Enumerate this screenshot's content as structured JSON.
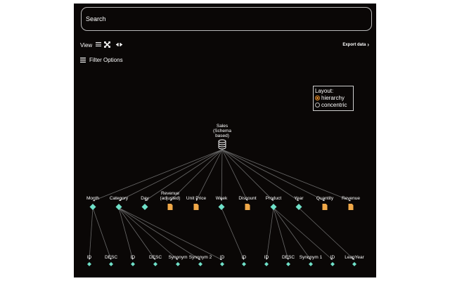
{
  "search": {
    "placeholder": "Search"
  },
  "toolbar": {
    "view_label": "View",
    "icons": [
      "list-icon",
      "expand-icon",
      "collapse-icon"
    ],
    "export_label": "Export data"
  },
  "filter": {
    "label": "Filter Options"
  },
  "layout": {
    "title": "Layout:",
    "options": [
      {
        "label": "hierarchy",
        "selected": true
      },
      {
        "label": "concentric",
        "selected": false
      }
    ]
  },
  "colors": {
    "background": "#0a0706",
    "diamond_node": "#6fe0c8",
    "file_node": "#f0a848",
    "edge": "#6a6a6a",
    "radio_selected": "#e08a2a"
  },
  "graph": {
    "root": {
      "label_lines": [
        "Sales",
        "(Schema",
        "based)"
      ],
      "icon": "database-icon"
    },
    "level1": [
      {
        "lines": [
          "Month"
        ],
        "type": "diamond"
      },
      {
        "lines": [
          "Category"
        ],
        "type": "diamond"
      },
      {
        "lines": [
          "Day"
        ],
        "type": "diamond"
      },
      {
        "lines": [
          "Revenue",
          "(adjusted)"
        ],
        "type": "file"
      },
      {
        "lines": [
          "Unit Price"
        ],
        "type": "file"
      },
      {
        "lines": [
          "Week"
        ],
        "type": "diamond"
      },
      {
        "lines": [
          "Discount"
        ],
        "type": "file"
      },
      {
        "lines": [
          "Product"
        ],
        "type": "diamond"
      },
      {
        "lines": [
          "Year"
        ],
        "type": "diamond"
      },
      {
        "lines": [
          "Quantity"
        ],
        "type": "file"
      },
      {
        "lines": [
          "Revenue"
        ],
        "type": "file"
      }
    ],
    "level2": [
      {
        "label": "ID",
        "parent": 0
      },
      {
        "label": "DESC",
        "parent": 0
      },
      {
        "label": "ID",
        "parent": 1
      },
      {
        "label": "DESC",
        "parent": 1
      },
      {
        "label": "Synonym",
        "parent": 1
      },
      {
        "label": "Synonym 2",
        "parent": 1
      },
      {
        "label": "ID",
        "parent": 1
      },
      {
        "label": "ID",
        "parent": 5
      },
      {
        "label": "ID",
        "parent": 7
      },
      {
        "label": "DESC",
        "parent": 7
      },
      {
        "label": "Synonym 1",
        "parent": 7
      },
      {
        "label": "ID",
        "parent": 7
      },
      {
        "label": "LeapYear",
        "parent": 8
      }
    ]
  }
}
